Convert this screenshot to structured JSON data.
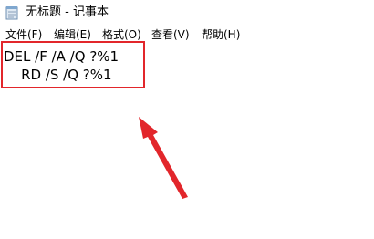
{
  "window": {
    "title": "无标题 - 记事本",
    "app_icon": "notepad-icon"
  },
  "menu": {
    "items": [
      {
        "label": "文件(F)"
      },
      {
        "label": "编辑(E)"
      },
      {
        "label": "格式(O)"
      },
      {
        "label": "查看(V)"
      },
      {
        "label": "帮助(H)"
      }
    ]
  },
  "editor": {
    "lines": [
      "DEL /F /A /Q ?%1",
      "    RD /S /Q ?%1"
    ]
  },
  "annotation": {
    "color": "#e2262b",
    "arrow_icon": "red-arrow-icon"
  }
}
